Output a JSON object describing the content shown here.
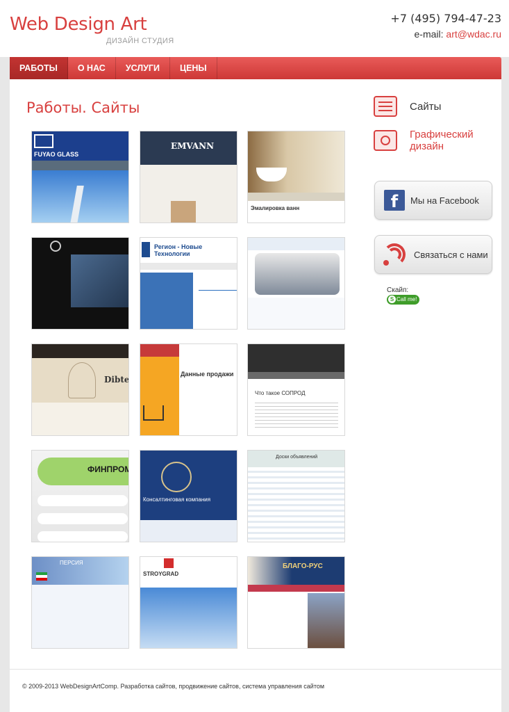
{
  "header": {
    "logo": "Web Design Art",
    "tagline": "ДИЗАЙН СТУДИЯ",
    "phone": "+7 (495) 794-47-23",
    "email_label": "e-mail: ",
    "email": "art@wdac.ru"
  },
  "nav": {
    "items": [
      {
        "label": "РАБОТЫ",
        "active": true
      },
      {
        "label": "О НАС"
      },
      {
        "label": "УСЛУГИ"
      },
      {
        "label": "ЦЕНЫ"
      }
    ]
  },
  "main": {
    "title": "Работы. Сайты"
  },
  "thumbnails": [
    {
      "name": "fuyao-glass",
      "text": "FUYAO GLASS"
    },
    {
      "name": "emvann",
      "text": "EMVANN"
    },
    {
      "name": "emalirovka",
      "text": "Эмалировка ванн"
    },
    {
      "name": "dark-jeans",
      "text": ""
    },
    {
      "name": "region",
      "text": "Регион - Новые Технологии"
    },
    {
      "name": "equipment",
      "text": ""
    },
    {
      "name": "dibtex",
      "text": "Dibtex"
    },
    {
      "name": "dannye-prodazh",
      "text": "Данные продажи"
    },
    {
      "name": "soprod",
      "text": "Что такое СОПРОД"
    },
    {
      "name": "finprom",
      "text": "ФИНПРОМ"
    },
    {
      "name": "consulting",
      "text": "Консалтинговая компания"
    },
    {
      "name": "doski-obyavlenii",
      "text": "Доски объявлений"
    },
    {
      "name": "persia",
      "text": "ПЕРСИЯ"
    },
    {
      "name": "stroygrad",
      "text": "STROYGRAD"
    },
    {
      "name": "blago-rus",
      "text": "БЛАГО-РУС"
    }
  ],
  "sidebar": {
    "sites_label": "Сайты",
    "graphic_label_line1": "Графический",
    "graphic_label_line2": "дизайн",
    "facebook_label": "Мы на Facebook",
    "contact_label": "Связаться с нами",
    "skype_label": "Скайп:",
    "skype_button": "Call me!"
  },
  "footer": {
    "copyright": "© 2009-2013 WebDesignArtComp. Разработка сайтов, продвижение сайтов, система управления сайтом"
  }
}
